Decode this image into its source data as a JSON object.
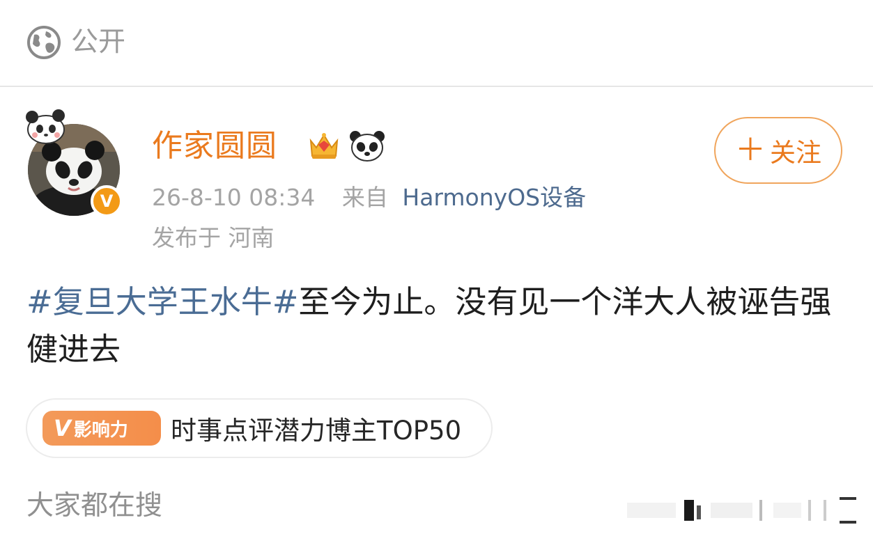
{
  "header": {
    "visibility_label": "公开",
    "globe_icon": "globe-icon"
  },
  "post": {
    "author": {
      "name": "作家圆圆",
      "badges": [
        "crown-icon",
        "panda-icon"
      ],
      "verified_badge": "V"
    },
    "follow_button": {
      "label": "关注",
      "icon": "plus-icon"
    },
    "timestamp": "26-8-10 08:34",
    "source_prefix": "来自",
    "source_device": "HarmonyOS设备",
    "location": "发布于 河南",
    "hashtag": "#复旦大学王水牛#",
    "body": "至今为止。没有见一个洋大人被诬告强健进去",
    "influence_tag": {
      "badge_v": "V",
      "badge_label": "影响力",
      "text": "时事点评潜力博主TOP50"
    }
  },
  "search_section": {
    "label": "大家都在搜"
  },
  "colors": {
    "username": "#ea7a1e",
    "link": "#4a6c94",
    "meta": "#a4a4a4",
    "follow_border": "#f0a55c"
  }
}
